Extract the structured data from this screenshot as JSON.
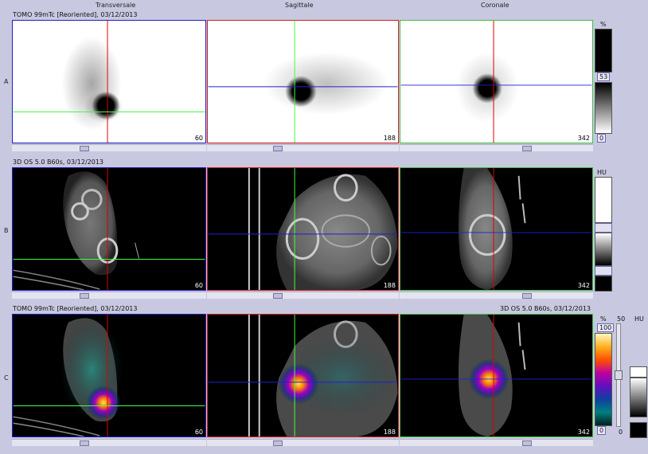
{
  "headers": {
    "transverse": "Transversale",
    "sagittal": "Sagittale",
    "coronal": "Coronale"
  },
  "rows": {
    "a": {
      "label": "A",
      "title": "TOMO 99mTc [Reoriented], 03/12/2013"
    },
    "b": {
      "label": "B",
      "title": "3D OS 5.0 B60s, 03/12/2013"
    },
    "c": {
      "label": "C",
      "title": "TOMO 99mTc [Reoriented], 03/12/2013",
      "title_right": "3D OS 5.0 B60s, 03/12/2013"
    }
  },
  "slices": {
    "transverse": "60",
    "sagittal": "188",
    "coronal": "342"
  },
  "colorbars": {
    "a": {
      "unit": "%",
      "max": "53",
      "min": "0"
    },
    "b": {
      "unit": "HU"
    },
    "c": {
      "unit_pct": "%",
      "unit_hu": "HU",
      "max": "100",
      "mid": "50",
      "min": "0",
      "min2": "0"
    }
  },
  "colors": {
    "background": "#c8c8e0",
    "red_cursor": "#e00000",
    "green_cursor": "#40ff40",
    "blue_cursor": "#2020d0",
    "panel_border_blue": "#2020c0",
    "panel_border_red": "#d02020",
    "panel_border_green": "#40c040"
  }
}
